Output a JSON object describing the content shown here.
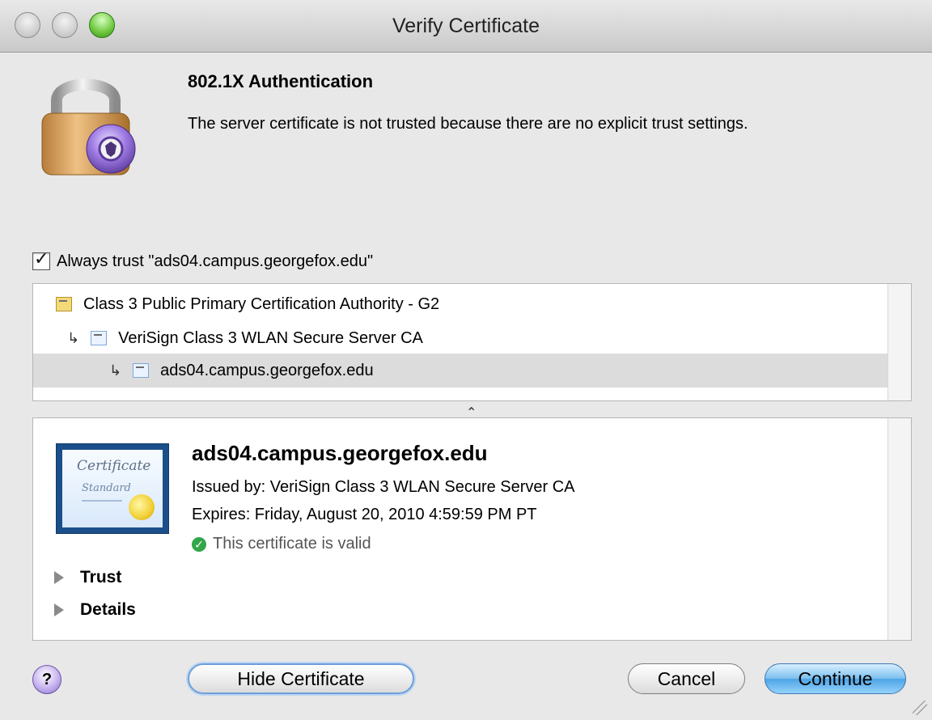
{
  "window": {
    "title": "Verify Certificate"
  },
  "alert": {
    "heading": "802.1X Authentication",
    "message": "The server certificate is not trusted because there are no explicit trust settings."
  },
  "trust_option": {
    "label": "Always trust \"ads04.campus.georgefox.edu\"",
    "checked": true
  },
  "chain": [
    {
      "label": "Class 3 Public Primary Certification Authority - G2",
      "icon": "root-certificate-icon"
    },
    {
      "label": "VeriSign Class 3 WLAN Secure Server CA",
      "icon": "intermediate-certificate-icon"
    },
    {
      "label": "ads04.campus.georgefox.edu",
      "icon": "server-certificate-icon",
      "selected": true
    }
  ],
  "details": {
    "name": "ads04.campus.georgefox.edu",
    "issued_by": "Issued by: VeriSign Class 3 WLAN Secure Server CA",
    "expires": "Expires: Friday, August 20, 2010 4:59:59 PM PT",
    "status": "This certificate is valid",
    "certificate_image": {
      "text1": "Certificate",
      "text2": "Standard"
    },
    "sections": [
      "Trust",
      "Details"
    ]
  },
  "buttons": {
    "help": "?",
    "hide_certificate": "Hide Certificate",
    "cancel": "Cancel",
    "continue": "Continue"
  },
  "colors": {
    "accent": "#4ea5e6",
    "valid": "#33a64a"
  }
}
